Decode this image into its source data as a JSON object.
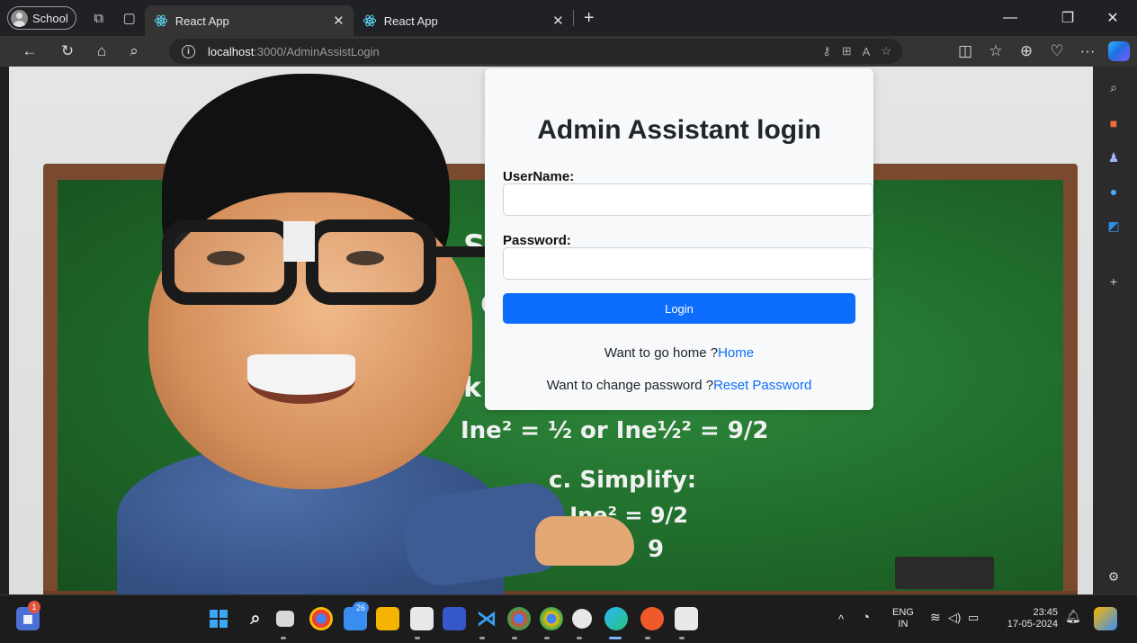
{
  "browser": {
    "profile_label": "School",
    "tabs": [
      {
        "title": "React App",
        "close": "✕"
      },
      {
        "title": "React App",
        "close": "✕"
      }
    ],
    "new_tab": "+",
    "window": {
      "minimize": "—",
      "restore": "❐",
      "close": "✕"
    },
    "url_host": "localhost",
    "url_rest": ":3000/AdminAssistLogin",
    "more": "···"
  },
  "chalkboard": {
    "line1": "Se",
    "line2": "a. C",
    "line3": "b. Tak",
    "line4": "Ine² = ½ or Ine½² = 9/2",
    "line5": "c. Simplify:",
    "line6": "½ Ine² = 9/2",
    "line7": "9"
  },
  "login": {
    "title": "Admin Assistant login",
    "username_label": "UserName:",
    "username_value": "",
    "password_label": "Password:",
    "password_value": "",
    "button_label": "Login",
    "home_prompt": "Want to go home ?",
    "home_link": "Home",
    "reset_prompt": "Want to change password ?",
    "reset_link": "Reset Password"
  },
  "taskbar": {
    "widget_badge": "1",
    "store_badge": "26",
    "language_top": "ENG",
    "language_bottom": "IN",
    "time": "23:45",
    "date": "17-05-2024",
    "tray_chevron": "^"
  },
  "colors": {
    "accent": "#0d6efd",
    "card_bg": "#f8f9fa",
    "browser_dark": "#202124"
  }
}
